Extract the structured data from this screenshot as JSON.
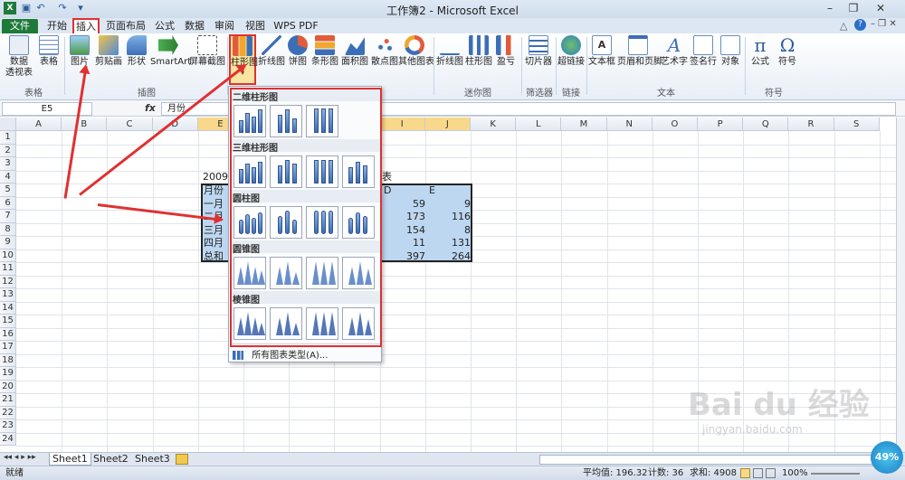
{
  "window": {
    "title": "工作簿2 - Microsoft Excel"
  },
  "tabs": [
    {
      "label": "文件"
    },
    {
      "label": "开始"
    },
    {
      "label": "插入"
    },
    {
      "label": "页面布局"
    },
    {
      "label": "公式"
    },
    {
      "label": "数据"
    },
    {
      "label": "审阅"
    },
    {
      "label": "视图"
    },
    {
      "label": "WPS PDF"
    }
  ],
  "ribbon": {
    "buttons": {
      "pivot": "数据\n透视表",
      "table": "表格",
      "picture": "图片",
      "clipart": "剪贴画",
      "shapes": "形状",
      "smartart": "SmartArt",
      "screenshot": "屏幕截图",
      "column": "柱形图",
      "line": "折线图",
      "pie": "饼图",
      "bar": "条形图",
      "area": "面积图",
      "scatter": "散点图",
      "other": "其他图表",
      "spark_line": "折线图",
      "spark_col": "柱形图",
      "spark_win": "盈亏",
      "slicer": "切片器",
      "hyperlink": "超链接",
      "textbox": "文本框",
      "header": "页眉和页脚",
      "wordart": "艺术字",
      "signature": "签名行",
      "object": "对象",
      "formula": "公式",
      "symbol": "符号"
    },
    "groups": {
      "tables": "表格",
      "illustrations": "插图",
      "sparklines": "迷你图",
      "filter": "筛选器",
      "links": "链接",
      "text": "文本",
      "symbols": "符号"
    }
  },
  "formula_bar": {
    "name_box": "E5",
    "fx": "fx",
    "content": "月份"
  },
  "grid": {
    "columns": [
      "A",
      "B",
      "C",
      "D",
      "E",
      "F",
      "G",
      "H",
      "I",
      "J",
      "K",
      "L",
      "M",
      "N",
      "O",
      "P",
      "Q",
      "R",
      "S"
    ],
    "rows": [
      "1",
      "2",
      "3",
      "4",
      "5",
      "6",
      "7",
      "8",
      "9",
      "10",
      "11",
      "12",
      "13",
      "14",
      "15",
      "16",
      "17",
      "18",
      "19",
      "20",
      "21",
      "22",
      "23",
      "24"
    ],
    "cells": {
      "title": "2009年",
      "title_tail": "表",
      "hdr_month": "月份",
      "hdr_d": "D",
      "hdr_e": "E",
      "months": [
        "一月",
        "二月",
        "三月",
        "四月",
        "总和"
      ],
      "col_d": [
        "59",
        "173",
        "154",
        "11",
        "397"
      ],
      "col_e": [
        "9",
        "116",
        "8",
        "131",
        "264"
      ]
    }
  },
  "gallery": {
    "sections": [
      "二维柱形图",
      "三维柱形图",
      "圆柱图",
      "圆锥图",
      "棱锥图"
    ],
    "all_types": "所有图表类型(A)..."
  },
  "sheets": [
    "Sheet1",
    "Sheet2",
    "Sheet3"
  ],
  "status": {
    "ready": "就绪",
    "average": "平均值: 196.32",
    "count": "计数: 36",
    "sum": "求和: 4908",
    "zoom": "100%"
  },
  "badge": "49%",
  "watermark": {
    "brand": "Bai du 经验",
    "url": "jingyan.baidu.com"
  },
  "colors": {
    "accent_red": "#e03030",
    "file_tab": "#1f7a3a",
    "selection": "#bdd7f1"
  }
}
